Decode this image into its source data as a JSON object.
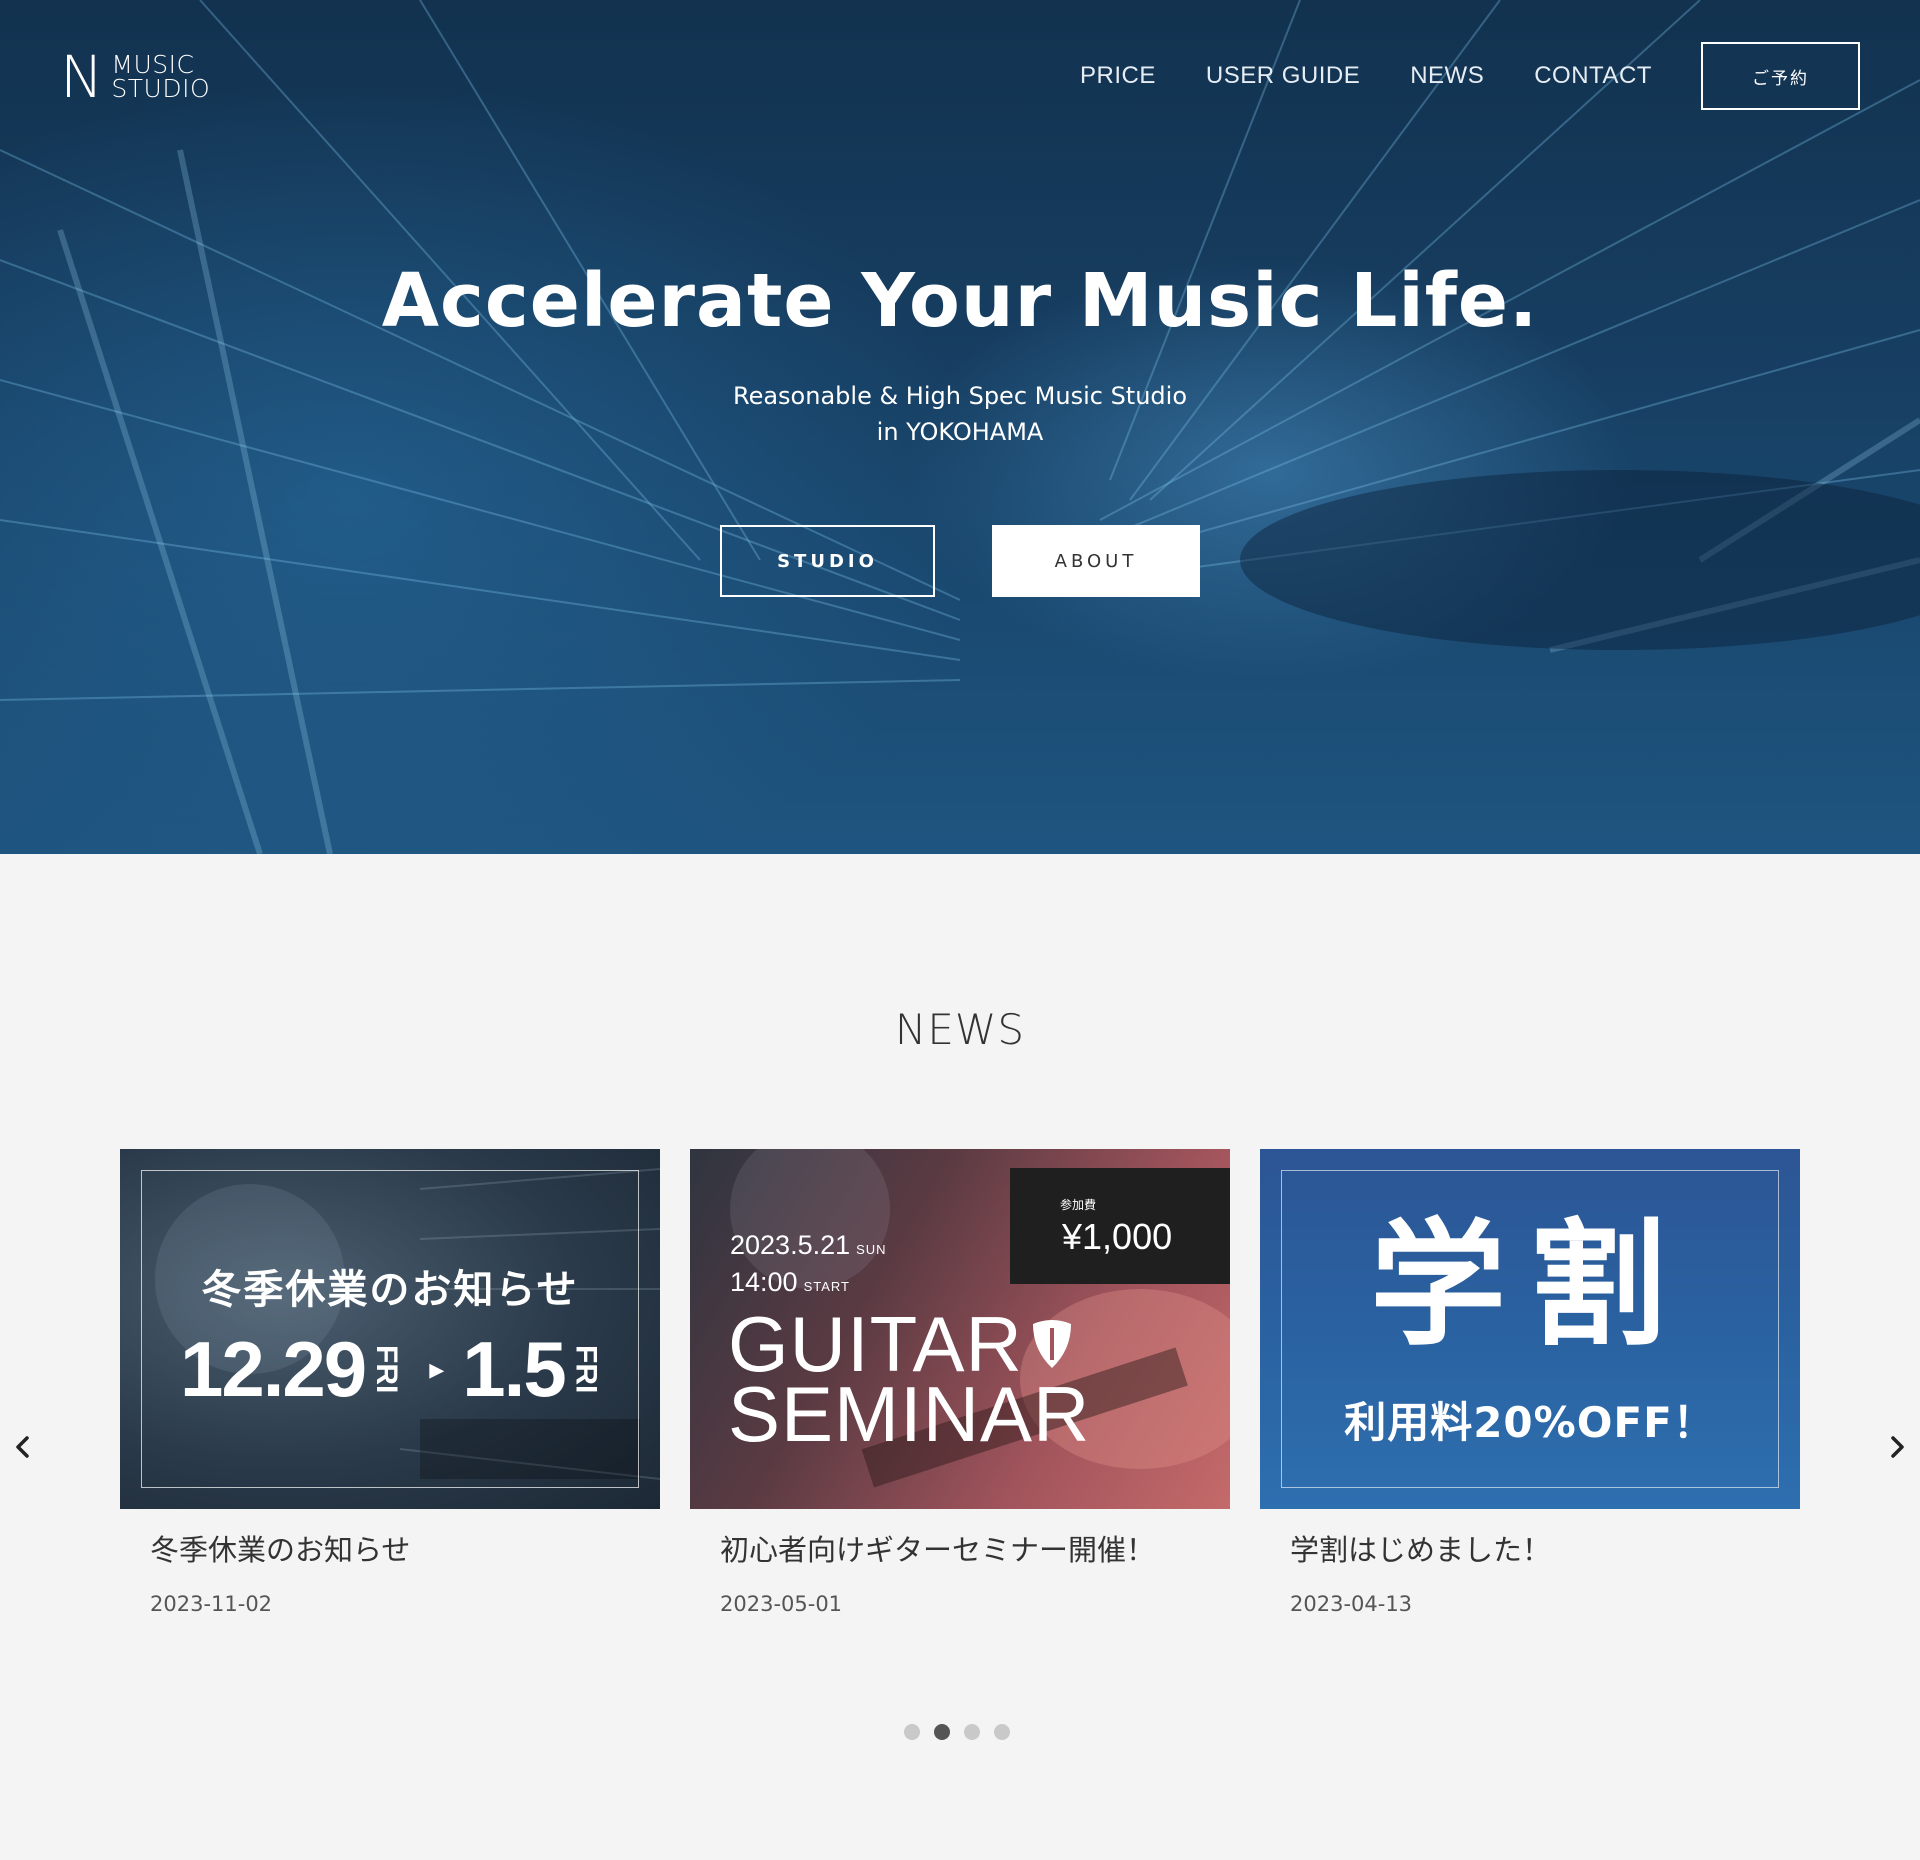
{
  "brand": {
    "logo_letter": "N",
    "logo_line1": "MUSIC",
    "logo_line2": "STUDIO"
  },
  "nav": {
    "items": [
      "PRICE",
      "USER GUIDE",
      "NEWS",
      "CONTACT"
    ],
    "reserve_label": "ご予約"
  },
  "hero": {
    "title": "Accelerate Your Music Life.",
    "subtitle_line1": "Reasonable & High Spec Music Studio",
    "subtitle_line2": "in YOKOHAMA",
    "btn_studio": "STUDIO",
    "btn_about": "ABOUT"
  },
  "news": {
    "heading": "NEWS",
    "cards": [
      {
        "title": "冬季休業のお知らせ",
        "date": "2023-11-02",
        "image": {
          "headline": "冬季休業のお知らせ",
          "start": "12.29",
          "start_dow": "FRI",
          "end": "1.5",
          "end_dow": "FRI",
          "arrow": "▸"
        }
      },
      {
        "title": "初心者向けギターセミナー開催！",
        "date": "2023-05-01",
        "image": {
          "fee_label": "参加費",
          "fee": "¥1,000",
          "event_date": "2023.5.21",
          "event_dow": "SUN",
          "event_time": "14:00",
          "time_label": "START",
          "line1": "GUITAR",
          "line2": "SEMINAR"
        }
      },
      {
        "title": "学割はじめました！",
        "date": "2023-04-13",
        "image": {
          "kanji": "学割",
          "discount": "利用料20%OFF！"
        }
      }
    ],
    "pagination": {
      "count": 4,
      "active_index": 1
    }
  },
  "icons": {
    "prev": "chevron-left-icon",
    "next": "chevron-right-icon",
    "guitar_pick": "guitar-pick-icon"
  }
}
